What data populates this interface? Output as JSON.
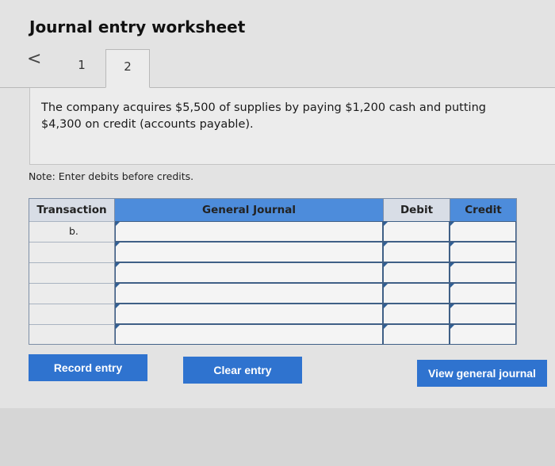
{
  "page": {
    "title": "Journal entry worksheet"
  },
  "tabs": {
    "back_symbol": "<",
    "items": [
      {
        "label": "1"
      },
      {
        "label": "2"
      }
    ],
    "active": "2"
  },
  "question": {
    "text": "The company acquires $5,500 of supplies by paying $1,200 cash and putting $4,300 on credit (accounts payable)."
  },
  "note": "Note: Enter debits before credits.",
  "journal": {
    "headers": {
      "transaction": "Transaction",
      "general_journal": "General Journal",
      "debit": "Debit",
      "credit": "Credit"
    },
    "rows": [
      {
        "transaction": "b.",
        "account": "",
        "debit": "",
        "credit": ""
      },
      {
        "transaction": "",
        "account": "",
        "debit": "",
        "credit": ""
      },
      {
        "transaction": "",
        "account": "",
        "debit": "",
        "credit": ""
      },
      {
        "transaction": "",
        "account": "",
        "debit": "",
        "credit": ""
      },
      {
        "transaction": "",
        "account": "",
        "debit": "",
        "credit": ""
      },
      {
        "transaction": "",
        "account": "",
        "debit": "",
        "credit": ""
      }
    ]
  },
  "buttons": {
    "record": "Record entry",
    "clear": "Clear entry",
    "view": "View general journal"
  },
  "colors": {
    "header_blue": "#4d8cdb",
    "button_blue": "#2f73cf"
  }
}
